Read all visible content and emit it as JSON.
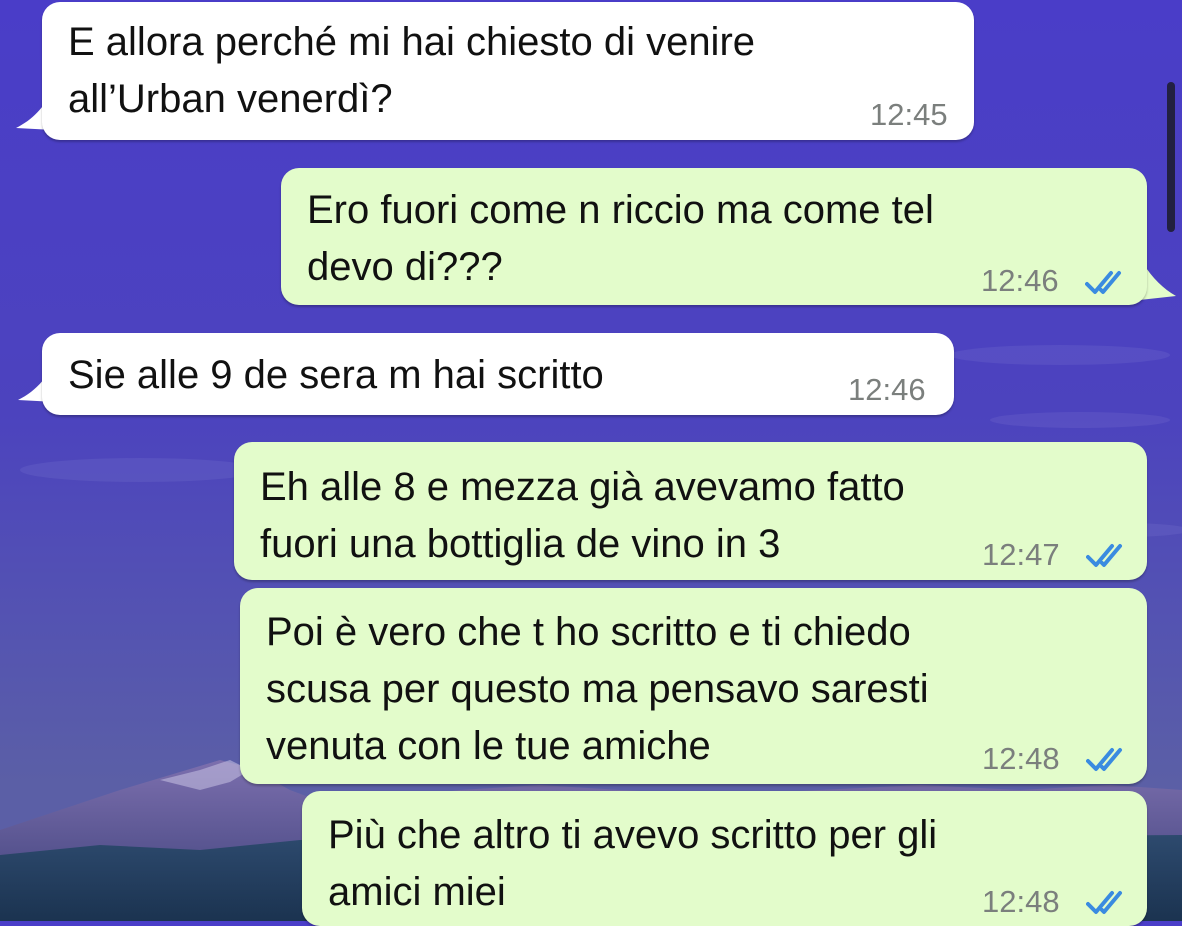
{
  "chat": {
    "messages": [
      {
        "direction": "incoming",
        "text": "E allora perché mi hai chiesto di venire\nall’Urban venerdì?",
        "time": "12:45"
      },
      {
        "direction": "outgoing",
        "text": "Ero fuori come n riccio ma come tel\ndevo di???",
        "time": "12:46",
        "status": "read"
      },
      {
        "direction": "incoming",
        "text": "Sie alle 9 de sera m hai scritto",
        "time": "12:46"
      },
      {
        "direction": "outgoing",
        "text": "Eh alle 8 e mezza già avevamo fatto\nfuori una bottiglia de vino in 3",
        "time": "12:47",
        "status": "read"
      },
      {
        "direction": "outgoing",
        "text": "Poi è vero che t ho scritto e ti chiedo\nscusa per questo ma pensavo saresti\nvenuta con le tue amiche",
        "time": "12:48",
        "status": "read"
      },
      {
        "direction": "outgoing",
        "text": "Più che altro ti avevo scritto per gli\namici miei",
        "time": "12:48",
        "status": "read"
      }
    ]
  },
  "colors": {
    "incoming_bubble": "#ffffff",
    "outgoing_bubble": "#e3fccb",
    "read_ticks": "#3a8be0",
    "timestamp": "#7b7f7d"
  },
  "icons": {
    "read_status": "double-check-icon"
  }
}
